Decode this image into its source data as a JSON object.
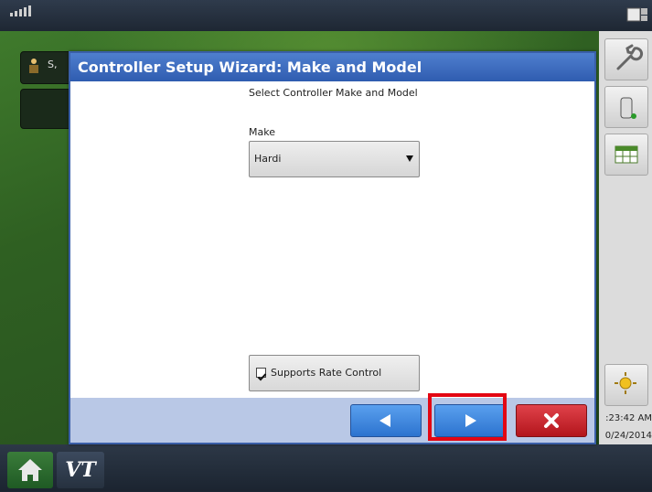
{
  "dialog": {
    "title": "Controller Setup Wizard:  Make and Model",
    "subtitle": "Select Controller Make and Model",
    "make_label": "Make",
    "make_value": "Hardi",
    "supports_rate_control_label": "Supports Rate Control",
    "supports_rate_control_checked": true
  },
  "background": {
    "tab_label": "S,",
    "time": ":23:42 AM",
    "date": "0/24/2014"
  },
  "bottom_bar": {
    "vt_label": "VT"
  },
  "icons": {
    "back": "left-arrow-icon",
    "next": "right-arrow-icon",
    "cancel": "close-icon",
    "home": "home-icon",
    "gps": "gps-signal-icon",
    "wrench": "wrench-icon",
    "bag": "product-bag-icon",
    "table": "table-icon",
    "sun": "brightness-icon"
  },
  "colors": {
    "title_bar": "#3a67bd",
    "nav_blue": "#2f7bd8",
    "cancel_red": "#c8232b",
    "highlight": "#e30613"
  }
}
